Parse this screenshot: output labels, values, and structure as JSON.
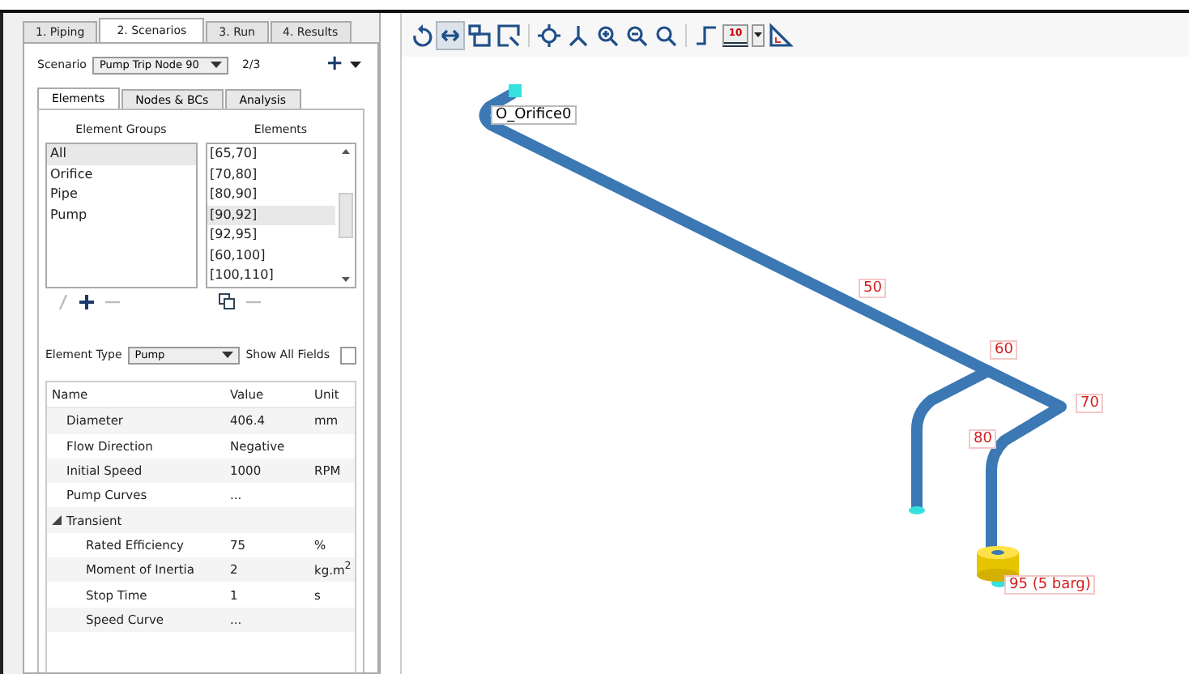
{
  "tabs": [
    {
      "label": "1. Piping",
      "selected": false
    },
    {
      "label": "2. Scenarios",
      "selected": true
    },
    {
      "label": "3. Run",
      "selected": false
    },
    {
      "label": "4. Results",
      "selected": false
    }
  ],
  "scenario": {
    "label": "Scenario",
    "value": "Pump Trip Node 90",
    "count": "2/3",
    "add": "+"
  },
  "subtabs": [
    {
      "label": "Elements",
      "selected": true
    },
    {
      "label": "Nodes & BCs",
      "selected": false
    },
    {
      "label": "Analysis",
      "selected": false
    }
  ],
  "element_groups": {
    "header": "Element Groups",
    "items": [
      {
        "label": "All",
        "selected": true
      },
      {
        "label": "Orifice",
        "selected": false
      },
      {
        "label": "Pipe",
        "selected": false
      },
      {
        "label": "Pump",
        "selected": false
      }
    ]
  },
  "elements": {
    "header": "Elements",
    "items": [
      {
        "label": "[65,70]",
        "selected": false
      },
      {
        "label": "[70,80]",
        "selected": false
      },
      {
        "label": "[80,90]",
        "selected": false
      },
      {
        "label": "[90,92]",
        "selected": true
      },
      {
        "label": "[92,95]",
        "selected": false
      },
      {
        "label": "[60,100]",
        "selected": false
      },
      {
        "label": "[100,110]",
        "selected": false
      }
    ]
  },
  "element_type": {
    "label": "Element Type",
    "value": "Pump"
  },
  "show_all_fields": {
    "label": "Show All Fields",
    "checked": false
  },
  "properties": {
    "columns": [
      "Name",
      "Value",
      "Unit"
    ],
    "rows": [
      {
        "name": "Diameter",
        "value": "406.4",
        "unit": "mm"
      },
      {
        "name": "Flow Direction",
        "value": "Negative"
      },
      {
        "name": "Initial Speed",
        "value": "1000",
        "unit": "RPM"
      },
      {
        "name": "Pump Curves",
        "value": "..."
      },
      {
        "name": "Transient",
        "expanded": true,
        "children": [
          {
            "name": "Rated Efficiency",
            "value": "75",
            "unit": "%"
          },
          {
            "name": "Moment of Inertia",
            "value": "2",
            "unit": "kg.m$^{2}$"
          },
          {
            "name": "Stop Time",
            "value": "1",
            "unit": "s"
          },
          {
            "name": "Speed Curve",
            "value": "..."
          }
        ]
      }
    ]
  },
  "toolbar": {
    "scale_label": "10"
  },
  "canvas": {
    "labels": [
      {
        "text": "O_Orifice0",
        "kind": "name"
      },
      {
        "text": "50",
        "kind": "node"
      },
      {
        "text": "60",
        "kind": "node"
      },
      {
        "text": "70",
        "kind": "node"
      },
      {
        "text": "80",
        "kind": "node"
      },
      {
        "text": "95 (5 barg)",
        "kind": "node"
      }
    ]
  }
}
